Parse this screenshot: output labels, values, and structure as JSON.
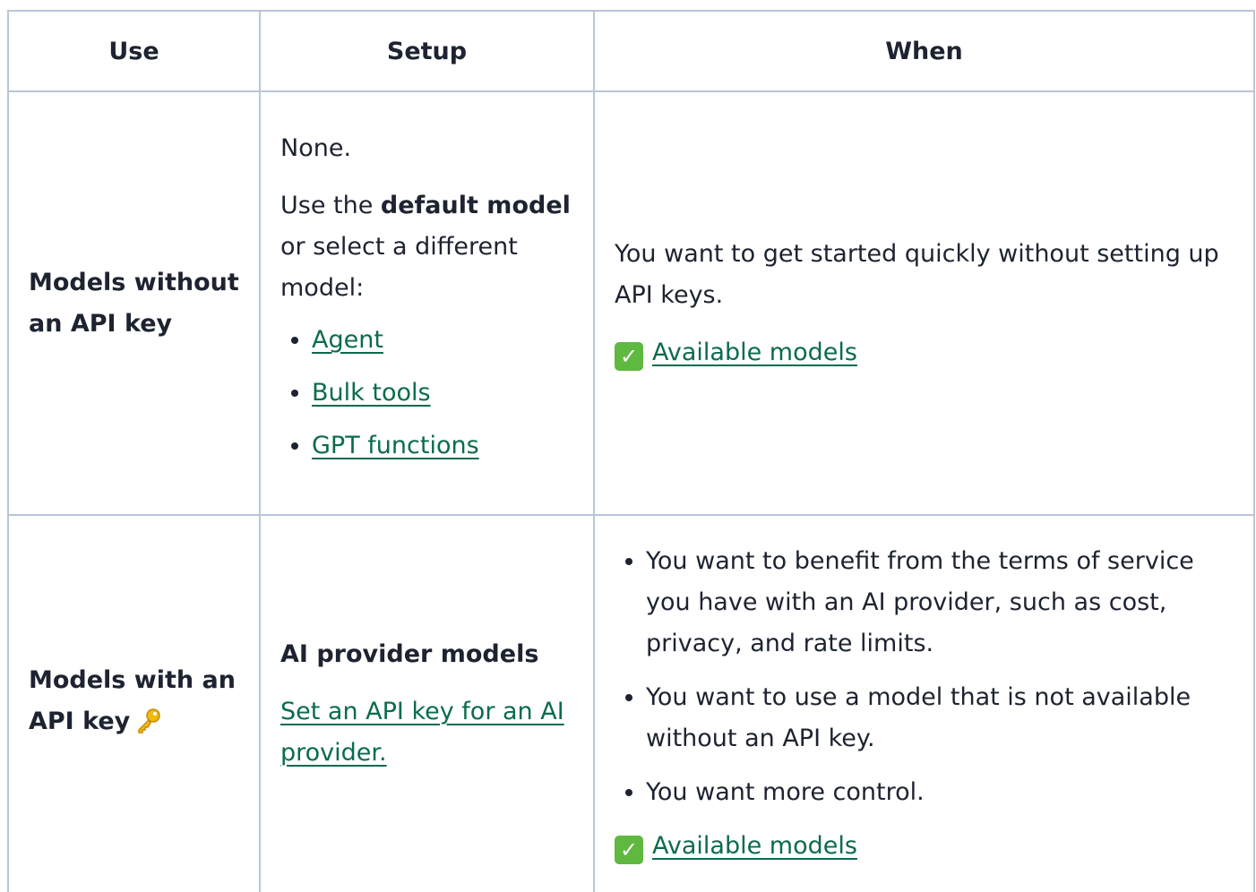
{
  "headers": {
    "use": "Use",
    "setup": "Setup",
    "when": "When"
  },
  "row_no_key": {
    "use": "Models without an API key",
    "setup_intro": "None.",
    "setup_text_before": "Use the ",
    "setup_bold": "default model",
    "setup_text_after": " or select a different model:",
    "setup_links": [
      "Agent",
      "Bulk tools",
      "GPT functions"
    ],
    "when_text": "You want to get started quickly without setting up API keys.",
    "when_link": "Available models"
  },
  "row_with_key": {
    "use": "Models with an API key",
    "use_icon": "key-icon",
    "setup_heading": "AI provider models",
    "setup_link": "Set an API key for an AI provider.",
    "when_items": [
      "You want to benefit from the terms of service you have with an AI provider, such as cost, privacy, and rate limits.",
      "You want to use a model that is not available without an API key.",
      "You want more control."
    ],
    "when_link": "Available models"
  },
  "icons": {
    "check": "white-check-mark-icon",
    "check_glyph": "✓"
  },
  "colors": {
    "link": "#0b6b4e",
    "border": "#b9c6d6",
    "check_bg": "#5fb83f"
  }
}
